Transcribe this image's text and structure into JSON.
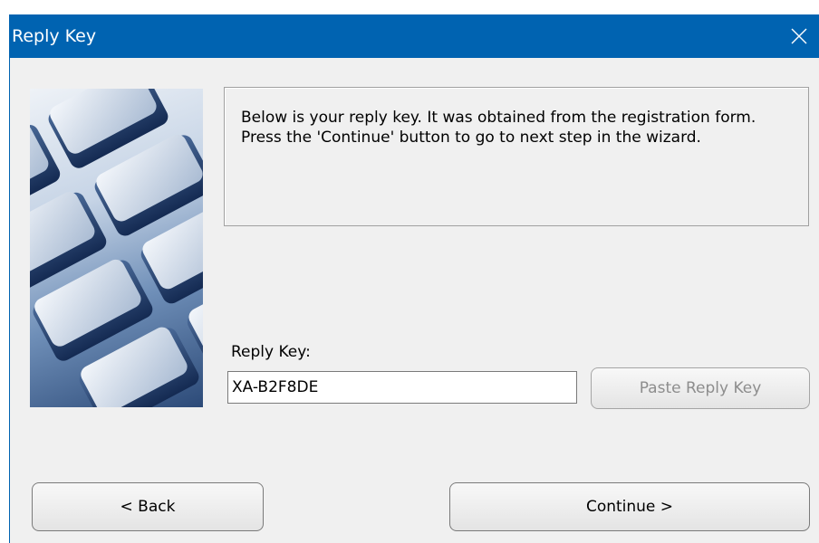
{
  "window": {
    "title": "Reply Key",
    "title_bar_color": "#0063b1",
    "close_icon": "close-icon"
  },
  "picture": {
    "icon": "keyboard-image"
  },
  "info": {
    "text": "Below is your reply key. It was obtained from the registration form. Press the 'Continue' button to go to next step in the wizard."
  },
  "reply_key": {
    "label": "Reply Key:",
    "value": "XA-B2F8DE",
    "paste_label": "Paste Reply Key"
  },
  "buttons": {
    "back_label": "< Back",
    "continue_label": "Continue >"
  }
}
